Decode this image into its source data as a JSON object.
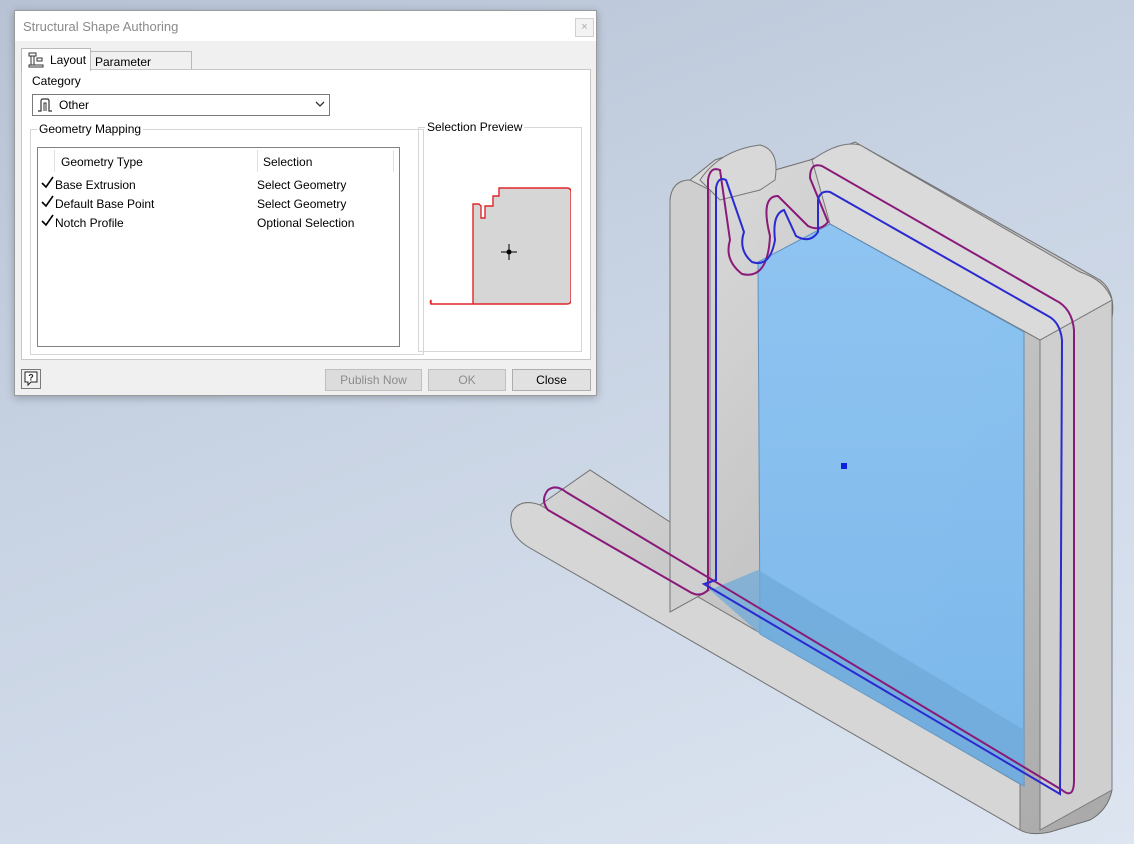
{
  "dialog": {
    "title": "Structural Shape Authoring",
    "close_glyph": "×",
    "tabs": [
      {
        "label": "Layout",
        "icon": "layout-icon",
        "active": true
      },
      {
        "label": "Parameter Mapping",
        "active": false
      }
    ],
    "category": {
      "label": "Category",
      "value": "Other",
      "icon": "profile-shape-icon"
    },
    "geometry_mapping": {
      "title": "Geometry Mapping",
      "columns": [
        "Geometry Type",
        "Selection"
      ],
      "rows": [
        {
          "type": "Base Extrusion",
          "selection": "Select Geometry",
          "checked": true
        },
        {
          "type": "Default Base Point",
          "selection": "Select Geometry",
          "checked": true
        },
        {
          "type": "Notch Profile",
          "selection": "Optional Selection",
          "checked": true
        }
      ]
    },
    "selection_preview": {
      "title": "Selection Preview"
    },
    "buttons": {
      "publish": "Publish Now",
      "ok": "OK",
      "close": "Close",
      "help_icon": "help-icon"
    }
  },
  "colors": {
    "selected_face": "#7fbdf0",
    "profile_outline_red": "#e0262b",
    "edge_purple": "#8a1a7a",
    "edge_blue": "#2a2ad0",
    "body_gray": "#c8c8c8"
  }
}
